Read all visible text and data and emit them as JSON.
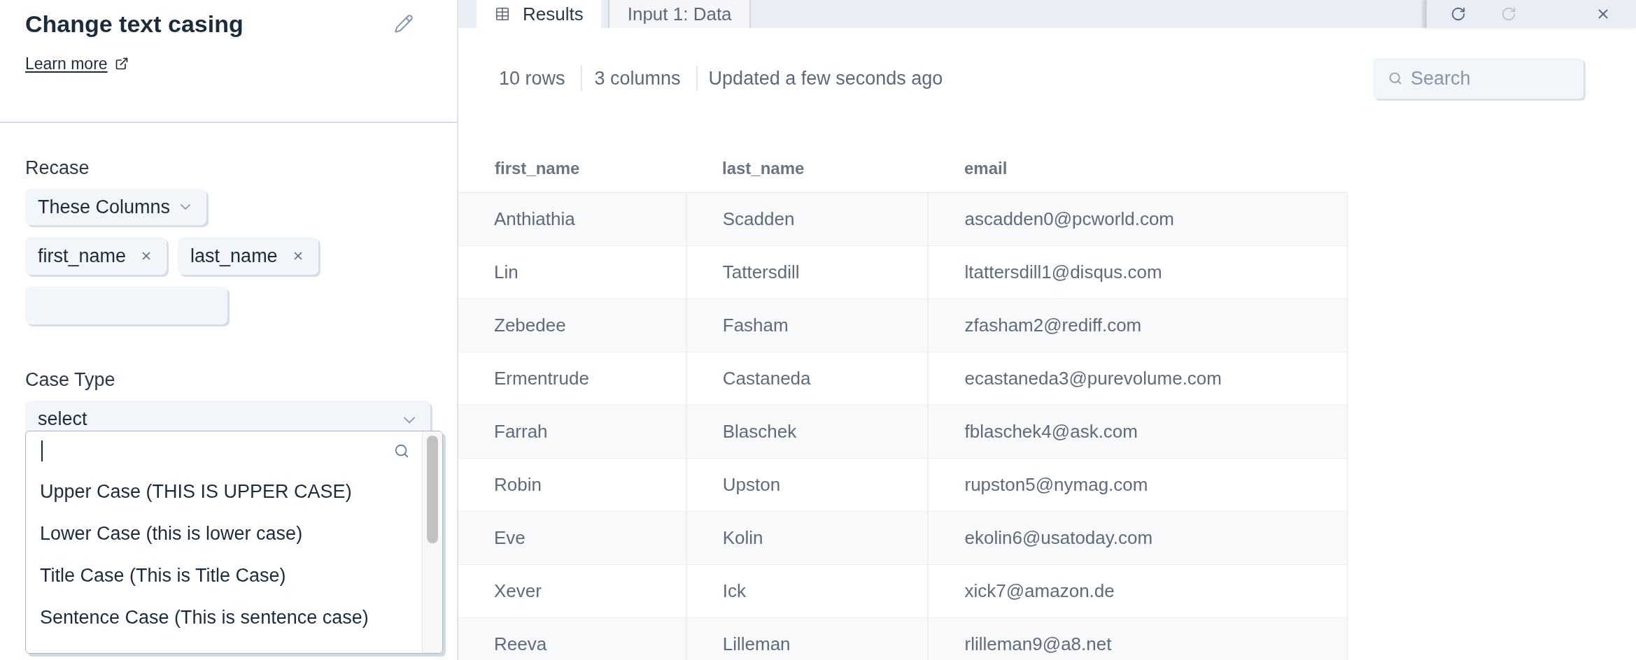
{
  "editor": {
    "title": "Change text casing",
    "learn_more": "Learn more",
    "recase": {
      "label": "Recase",
      "mode": "These Columns",
      "columns": [
        "first_name",
        "last_name"
      ]
    },
    "case_type": {
      "label": "Case Type",
      "value": "select",
      "expanded": true,
      "options": [
        {
          "label": "Upper Case (THIS IS UPPER CASE)",
          "selected": false
        },
        {
          "label": "Lower Case (this is lower case)",
          "selected": false
        },
        {
          "label": "Title Case (This is Title Case)",
          "selected": false
        },
        {
          "label": "Sentence Case (This is sentence case)",
          "selected": false
        }
      ]
    }
  },
  "tabs": [
    {
      "label": "Results",
      "kind": "results",
      "selected": true
    },
    {
      "label": "Input 1: Data",
      "kind": "input",
      "selected": false
    }
  ],
  "summary": {
    "rows": "10 rows",
    "columns": "3 columns",
    "updated": "Updated a few seconds ago"
  },
  "search": {
    "placeholder": "Search"
  },
  "table": {
    "columns": [
      "first_name",
      "last_name",
      "email"
    ],
    "rows": [
      [
        "Anthiathia",
        "Scadden",
        "ascadden0@pcworld.com"
      ],
      [
        "Lin",
        "Tattersdill",
        "ltattersdill1@disqus.com"
      ],
      [
        "Zebedee",
        "Fasham",
        "zfasham2@rediff.com"
      ],
      [
        "Ermentrude",
        "Castaneda",
        "ecastaneda3@purevolume.com"
      ],
      [
        "Farrah",
        "Blaschek",
        "fblaschek4@ask.com"
      ],
      [
        "Robin",
        "Upston",
        "rupston5@nymag.com"
      ],
      [
        "Eve",
        "Kolin",
        "ekolin6@usatoday.com"
      ],
      [
        "Xever",
        "Ick",
        "xick7@amazon.de"
      ],
      [
        "Reeva",
        "Lilleman",
        "rlilleman9@a8.net"
      ]
    ]
  }
}
